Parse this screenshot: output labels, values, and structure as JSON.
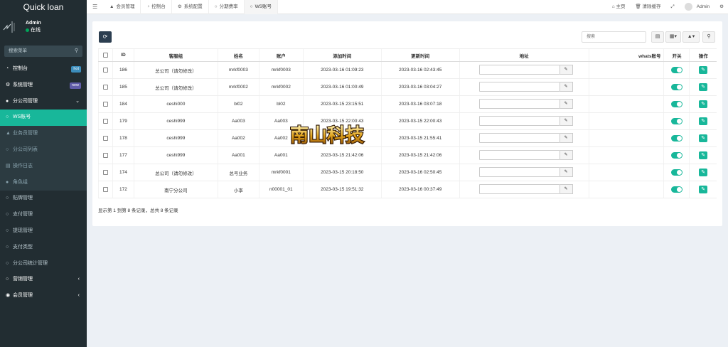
{
  "app": {
    "title": "Quick loan"
  },
  "user": {
    "name": "Admin",
    "status": "在线"
  },
  "sidebar": {
    "search_placeholder": "搜索菜单",
    "items": [
      {
        "label": "控制台",
        "icon": "dashboard-icon",
        "badge": "hot",
        "badge_color": "#3c8dbc"
      },
      {
        "label": "系统管理",
        "icon": "cogs-icon",
        "badge": "new",
        "badge_color": "#605ca8"
      },
      {
        "label": "分公司管理",
        "icon": "users-icon",
        "caret": "⌄"
      },
      {
        "label": "WS账号",
        "icon": "circle-icon"
      },
      {
        "label": "业务员管理",
        "icon": "user-icon"
      },
      {
        "label": "分公司列表",
        "icon": "circle-icon"
      },
      {
        "label": "操作日志",
        "icon": "list-icon"
      },
      {
        "label": "角色组",
        "icon": "group-icon"
      },
      {
        "label": "贴牌管理",
        "icon": "circle-icon"
      },
      {
        "label": "支付管理",
        "icon": "circle-icon"
      },
      {
        "label": "提现管理",
        "icon": "circle-icon"
      },
      {
        "label": "支付类型",
        "icon": "circle-icon"
      },
      {
        "label": "分公司统计管理",
        "icon": "circle-icon"
      },
      {
        "label": "营销管理",
        "icon": "circle-icon",
        "caret": "‹"
      },
      {
        "label": "会员管理",
        "icon": "user-circle-icon",
        "caret": "‹"
      }
    ]
  },
  "topnav": {
    "tabs": [
      {
        "label": "会员管理",
        "icon": "user-icon"
      },
      {
        "label": "控制台",
        "icon": "dashboard-icon"
      },
      {
        "label": "系统配置",
        "icon": "gear-icon"
      },
      {
        "label": "分期费率",
        "icon": "circle-icon"
      },
      {
        "label": "WS账号",
        "icon": "circle-icon"
      }
    ],
    "home": "主页",
    "clear_cache": "清除缓存",
    "admin": "Admin"
  },
  "toolbar": {
    "search_placeholder": "搜索"
  },
  "table": {
    "headers": [
      "ID",
      "客服组",
      "姓名",
      "账户",
      "添加时间",
      "更新时间",
      "地址",
      "whats账号",
      "开关",
      "操作"
    ],
    "rows": [
      {
        "id": "186",
        "group": "总公司（请勿修改）",
        "name": "mrkf0003",
        "account": "mrkf0003",
        "created": "2023-03-16 01:09:23",
        "updated": "2023-03-16 02:43:45"
      },
      {
        "id": "185",
        "group": "总公司（请勿修改）",
        "name": "mrkf0002",
        "account": "mrkf0002",
        "created": "2023-03-16 01:00:49",
        "updated": "2023-03-16 03:04:27"
      },
      {
        "id": "184",
        "group": "ceshi000",
        "name": "bl02",
        "account": "bl02",
        "created": "2023-03-15 23:15:51",
        "updated": "2023-03-16 03:07:18"
      },
      {
        "id": "179",
        "group": "ceshi999",
        "name": "Aa003",
        "account": "Aa003",
        "created": "2023-03-15 22:00:43",
        "updated": "2023-03-15 22:00:43"
      },
      {
        "id": "178",
        "group": "ceshi999",
        "name": "Aa002",
        "account": "Aa002",
        "created": "",
        "updated": "2023-03-15 21:55:41"
      },
      {
        "id": "177",
        "group": "ceshi999",
        "name": "Aa001",
        "account": "Aa001",
        "created": "2023-03-15 21:42:06",
        "updated": "2023-03-15 21:42:06"
      },
      {
        "id": "174",
        "group": "总公司（请勿修改）",
        "name": "总号业务",
        "account": "mrkf0001",
        "created": "2023-03-15 20:18:50",
        "updated": "2023-03-16 02:50:45"
      },
      {
        "id": "172",
        "group": "南宁分公司",
        "name": "小李",
        "account": "n00001_01",
        "created": "2023-03-15 19:51:32",
        "updated": "2023-03-16 00:37:49"
      }
    ]
  },
  "summary": "显示第 1 到第 8 条记录，总共 8 条记录",
  "watermark": {
    "text": "南山科技"
  },
  "colors": {
    "accent": "#18b79a",
    "sidebar": "#222d32",
    "primary_dark": "#2c3e50"
  }
}
